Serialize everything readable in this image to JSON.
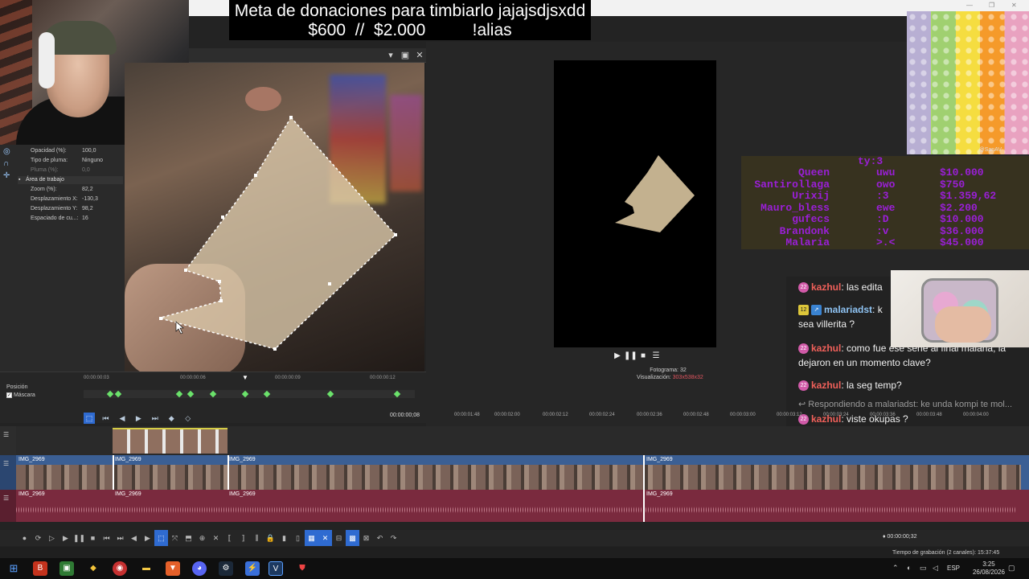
{
  "donation_banner": {
    "line1": "Meta de donaciones para timbiarlo jajajsdjsxdd",
    "line2": "$600  //  $2.000          !alias"
  },
  "properties": {
    "rows_top": [
      {
        "label": "Opacidad (%):",
        "value": "100,0"
      },
      {
        "label": "Tipo de pluma:",
        "value": "Ninguno"
      },
      {
        "label": "Pluma (%):",
        "value": "0,0"
      }
    ],
    "section": "Área de trabajo",
    "rows_work": [
      {
        "label": "Zoom (%):",
        "value": "82,2"
      },
      {
        "label": "Desplazamiento X:",
        "value": "-130,3"
      },
      {
        "label": "Desplazamiento Y:",
        "value": "98,2"
      },
      {
        "label": "Espaciado de cu...:",
        "value": "16"
      }
    ]
  },
  "keyframes": {
    "position_label": "Posición",
    "mask_label": "Máscara",
    "ruler": [
      "00:00:00:03",
      "00:00:00:06",
      "00:00:00:09",
      "00:00:00:12"
    ],
    "time": "00:00:00;08"
  },
  "preview_transport": {
    "frame_label": "Fotograma:",
    "frame_value": "32",
    "display_label": "Visualización:",
    "display_value": "303x538x32"
  },
  "donor_table": {
    "header": "ty:3",
    "rows": [
      {
        "name": "Queen",
        "emote": "uwu",
        "amount": "$10.000"
      },
      {
        "name": "Santirollaga",
        "emote": "owo",
        "amount": "$750"
      },
      {
        "name": "Urixij",
        "emote": ":3",
        "amount": "$1.359,62"
      },
      {
        "name": "Mauro_bless",
        "emote": "ewe",
        "amount": "$2.200"
      },
      {
        "name": "gufecs",
        "emote": ":D",
        "amount": "$10.000"
      },
      {
        "name": "Brandonk",
        "emote": ":v",
        "amount": "$36.000"
      },
      {
        "name": "Malaria",
        "emote": ">.<",
        "amount": "$45.000"
      }
    ]
  },
  "popit_tag": "@SanAV",
  "chat": [
    {
      "badge": "22",
      "user": "kazhul",
      "text": ": las edita",
      "type": "red"
    },
    {
      "badge": "12",
      "user": "malariadst",
      "text": ": k",
      "type": "blue",
      "cont": "sea villerita ?"
    },
    {
      "badge": "22",
      "user": "kazhul",
      "text": ": como fue ese serie al final malaria, la dejaron en un momento clave?",
      "type": "red"
    },
    {
      "badge": "22",
      "user": "kazhul",
      "text": ": la seg temp?",
      "type": "red"
    },
    {
      "reply": "Respondiendo a malariadst: ke unda kompi te mol..."
    },
    {
      "badge": "22",
      "user": "kazhul",
      "text": ": viste okupas ?",
      "type": "red"
    }
  ],
  "timeline": {
    "ruler": [
      "00:00:01:48",
      "00:00:02:00",
      "00:00:02:12",
      "00:00:02:24",
      "00:00:02:36",
      "00:00:02:48",
      "00:00:03:00",
      "00:00:03:12",
      "00:00:03:24",
      "00:00:03:36",
      "00:00:03:48",
      "00:00:04:00"
    ],
    "clip_name": "IMG_2969",
    "time": "00:00:00;32",
    "record_time": "Tiempo de grabación (2 canales): 15:37:45"
  },
  "taskbar": {
    "lang": "ESP",
    "time": "3:25",
    "date": "26/08/2026"
  }
}
